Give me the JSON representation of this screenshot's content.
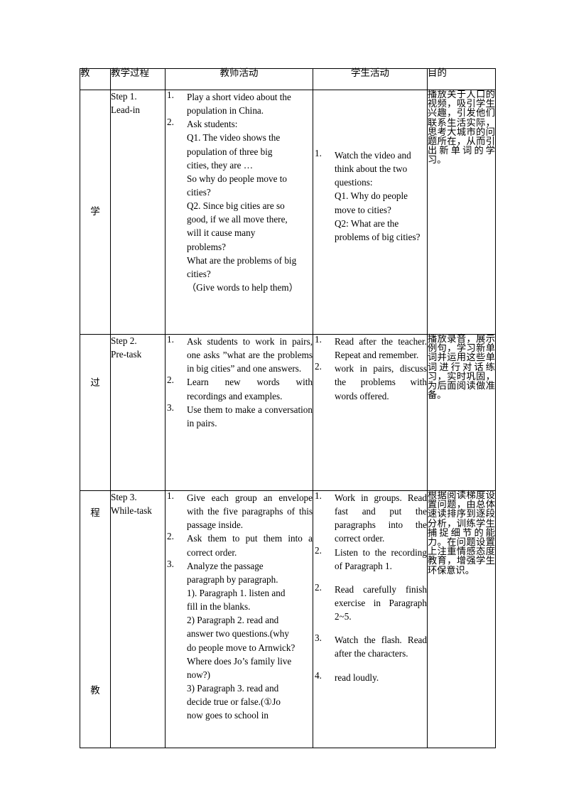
{
  "document": {
    "type": "lesson-plan-table",
    "title_column_header": "教"
  },
  "table": {
    "headers": {
      "stage": "教",
      "process": "教学过程",
      "teacher_activity": "教师活动",
      "student_activity": "学生活动",
      "purpose": "目的"
    },
    "stage_characters": [
      "学",
      "过",
      "程",
      "教"
    ],
    "rows": [
      {
        "stage_char": "学",
        "process": [
          "Step 1.",
          "Lead-in"
        ],
        "teacher_activity": {
          "items": [
            {
              "num": "1.",
              "lines": [
                "Play a short video about the",
                "population in China."
              ]
            },
            {
              "num": "2.",
              "lines": [
                "Ask students:",
                "Q1. The video shows the",
                "population of three big",
                "cities, they are …",
                "So why do people move to",
                "cities?",
                "Q2. Since big cities are so",
                "good, if we all move there,",
                "will it cause many",
                "problems?",
                "What are the problems of big",
                "cities?"
              ]
            }
          ],
          "note": "（Give words to help them）"
        },
        "student_activity": {
          "items": [
            {
              "num": "1.",
              "lines": [
                "Watch the video and",
                "think about the two",
                "questions:",
                "Q1. Why do people",
                "move to cities?",
                "Q2: What are the",
                "problems of big cities?"
              ]
            }
          ]
        },
        "purpose": "播放关于人口的视频，吸引学生兴趣，引发他们联系生活实际，思考大城市的问题所在，从而引出新单词的学习。"
      },
      {
        "stage_char": "过",
        "process": [
          "Step 2.",
          "Pre-task"
        ],
        "teacher_activity": {
          "items": [
            {
              "num": "1.",
              "text": "Ask students to work in pairs, one asks ”what are the problems in big cities” and one answers."
            },
            {
              "num": "2.",
              "text": "Learn new words with recordings and examples."
            },
            {
              "num": "3.",
              "text": "Use them to make a conversation in pairs."
            }
          ]
        },
        "student_activity": {
          "items": [
            {
              "num": "1.",
              "text": "Read after the teacher. Repeat and remember."
            },
            {
              "num": "2.",
              "text": "work in pairs, discuss the problems with words offered."
            }
          ]
        },
        "purpose": "播放录音，展示例句，学习新单词并运用这些单词进行对话练习，实时巩固，为后面阅读做准备。"
      },
      {
        "stage_char": "程",
        "stage_char_2": "教",
        "process": [
          "Step 3.",
          "While-task"
        ],
        "teacher_activity": {
          "items": [
            {
              "num": "1.",
              "text": "Give each group an envelope with the five paragraphs of this passage inside."
            },
            {
              "num": "2.",
              "text": "Ask them to put them into a correct order."
            },
            {
              "num": "3.",
              "lines": [
                "Analyze the passage",
                "paragraph by paragraph.",
                "1). Paragraph 1. listen and",
                "fill in the blanks.",
                "2) Paragraph 2. read and",
                "answer two questions.(why",
                "do people move to Arnwick?",
                "Where does Jo’s family live",
                "now?)",
                "3) Paragraph 3. read and",
                "decide true or false.(①Jo",
                "now goes to school in"
              ]
            }
          ]
        },
        "student_activity": {
          "items": [
            {
              "num": "1.",
              "text": "Work in groups. Read fast and put the paragraphs into the correct order."
            },
            {
              "num": "2.",
              "text": "Listen to the recording of Paragraph 1."
            },
            {
              "num": "2.",
              "text": "Read carefully finish exercise in Paragraph 2~5."
            },
            {
              "num": "3.",
              "text": "Watch the flash. Read after the characters."
            },
            {
              "num": "4.",
              "text": "read loudly."
            }
          ]
        },
        "purpose": "根据阅读梯度设置问题，由总体速读排序到逐段分析，训练学生捕捉细节的能力。在问题设置上注重情感态度教育，增强学生环保意识。"
      }
    ]
  }
}
